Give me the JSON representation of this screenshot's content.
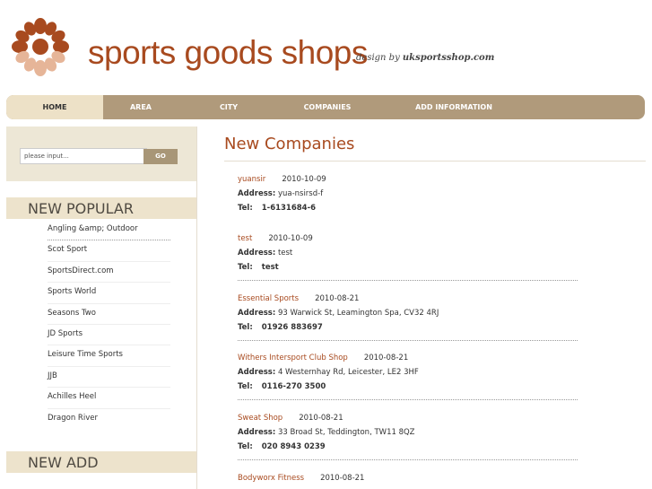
{
  "header": {
    "title": "sports goods shops",
    "design_by_prefix": "design by ",
    "design_by_site": "uksportsshop.com",
    "brand_colors": {
      "accent": "#a84a1f",
      "logo_light": "#e6b598"
    }
  },
  "nav": {
    "items": [
      {
        "label": "HOME",
        "active": true
      },
      {
        "label": "AREA"
      },
      {
        "label": "CITY"
      },
      {
        "label": "COMPANIES"
      },
      {
        "label": "ADD INFORMATION"
      }
    ]
  },
  "search": {
    "placeholder": "please input...",
    "go_label": "GO"
  },
  "sidebar": {
    "popular_heading": "NEW POPULAR",
    "popular_items": [
      "Angling &amp; Outdoor",
      "Scot Sport",
      "SportsDirect.com",
      "Sports World",
      "Seasons Two",
      "JD Sports",
      "Leisure Time Sports",
      "JJB",
      "Achilles Heel",
      "Dragon River"
    ],
    "add_heading": "NEW ADD"
  },
  "main": {
    "title": "New Companies",
    "address_label": "Address:",
    "tel_label": "Tel:",
    "companies": [
      {
        "name": "yuansir",
        "date": "2010-10-09",
        "address": "yua-nsirsd-f",
        "tel": "1-6131684-6"
      },
      {
        "name": "test",
        "date": "2010-10-09",
        "address": "test",
        "tel": "test"
      },
      {
        "name": "Essential Sports",
        "date": "2010-08-21",
        "address": "93 Warwick St, Leamington Spa, CV32 4RJ",
        "tel": "01926 883697"
      },
      {
        "name": "Withers Intersport Club Shop",
        "date": "2010-08-21",
        "address": "4 Westernhay Rd, Leicester, LE2 3HF",
        "tel": "0116-270 3500"
      },
      {
        "name": "Sweat Shop",
        "date": "2010-08-21",
        "address": "33 Broad St, Teddington, TW11 8QZ",
        "tel": "020 8943 0239"
      },
      {
        "name": "Bodyworx Fitness",
        "date": "2010-08-21"
      }
    ]
  }
}
